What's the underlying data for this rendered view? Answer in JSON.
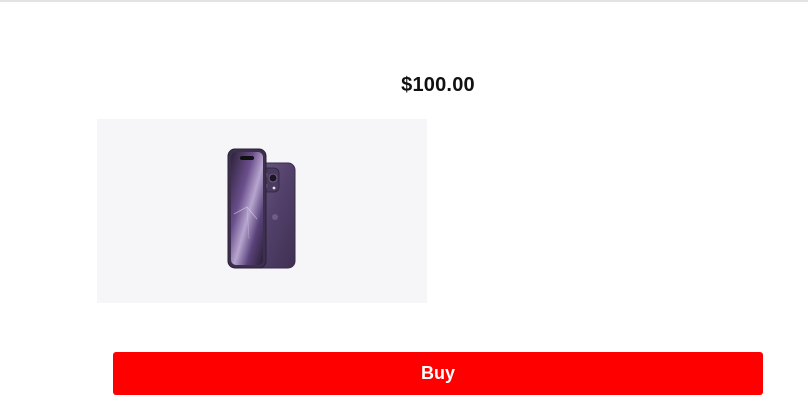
{
  "product": {
    "price": "$100.00",
    "image_icon": "smartphone-icon"
  },
  "actions": {
    "buy_label": "Buy"
  },
  "colors": {
    "buy_button": "#ff0000",
    "image_background": "#f6f5f8",
    "phone_body": "#5b4670"
  }
}
